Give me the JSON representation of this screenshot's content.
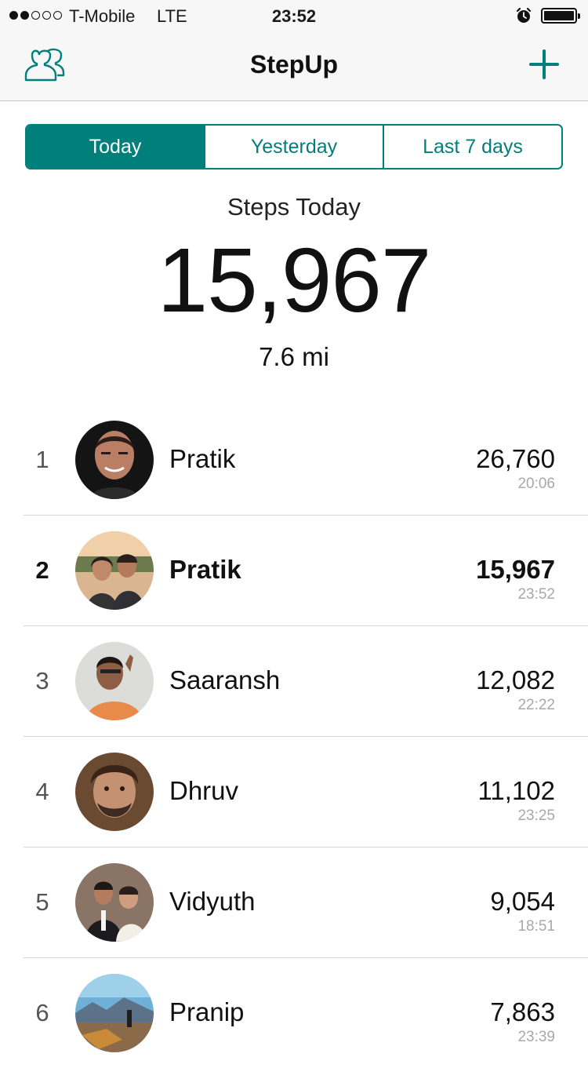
{
  "status_bar": {
    "carrier": "T-Mobile",
    "network": "LTE",
    "time": "23:52",
    "signal_bars_filled": 2,
    "signal_bars_total": 5
  },
  "nav": {
    "title": "StepUp",
    "left_icon": "friends-icon",
    "right_icon": "plus-icon",
    "accent_color": "#007f7b"
  },
  "tabs": [
    {
      "label": "Today",
      "active": true
    },
    {
      "label": "Yesterday",
      "active": false
    },
    {
      "label": "Last 7 days",
      "active": false
    }
  ],
  "summary": {
    "label": "Steps Today",
    "steps": "15,967",
    "distance": "7.6 mi"
  },
  "leaderboard": [
    {
      "rank": "1",
      "name": "Pratik",
      "steps": "26,760",
      "time": "20:06",
      "me": false
    },
    {
      "rank": "2",
      "name": "Pratik",
      "steps": "15,967",
      "time": "23:52",
      "me": true
    },
    {
      "rank": "3",
      "name": "Saaransh",
      "steps": "12,082",
      "time": "22:22",
      "me": false
    },
    {
      "rank": "4",
      "name": "Dhruv",
      "steps": "11,102",
      "time": "23:25",
      "me": false
    },
    {
      "rank": "5",
      "name": "Vidyuth",
      "steps": "9,054",
      "time": "18:51",
      "me": false
    },
    {
      "rank": "6",
      "name": "Pranip",
      "steps": "7,863",
      "time": "23:39",
      "me": false
    }
  ]
}
